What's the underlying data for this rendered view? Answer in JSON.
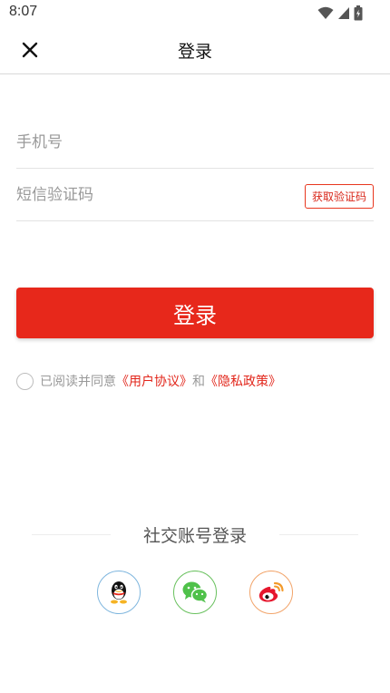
{
  "status_bar": {
    "time": "8:07"
  },
  "header": {
    "title": "登录"
  },
  "form": {
    "phone_placeholder": "手机号",
    "code_placeholder": "短信验证码",
    "get_code_label": "获取验证码",
    "login_label": "登录"
  },
  "agreement": {
    "prefix": "已阅读并同意",
    "user_agreement": "《用户协议》",
    "conjunction": "和",
    "privacy_policy": "《隐私政策》"
  },
  "social": {
    "title": "社交账号登录",
    "providers": [
      {
        "name": "qq-icon"
      },
      {
        "name": "wechat-icon"
      },
      {
        "name": "weibo-icon"
      }
    ]
  },
  "colors": {
    "accent": "#e7281b",
    "link": "#e2261b",
    "qq_border": "#7fb6de",
    "wechat": "#4fc14a",
    "weibo": "#e6162d"
  }
}
